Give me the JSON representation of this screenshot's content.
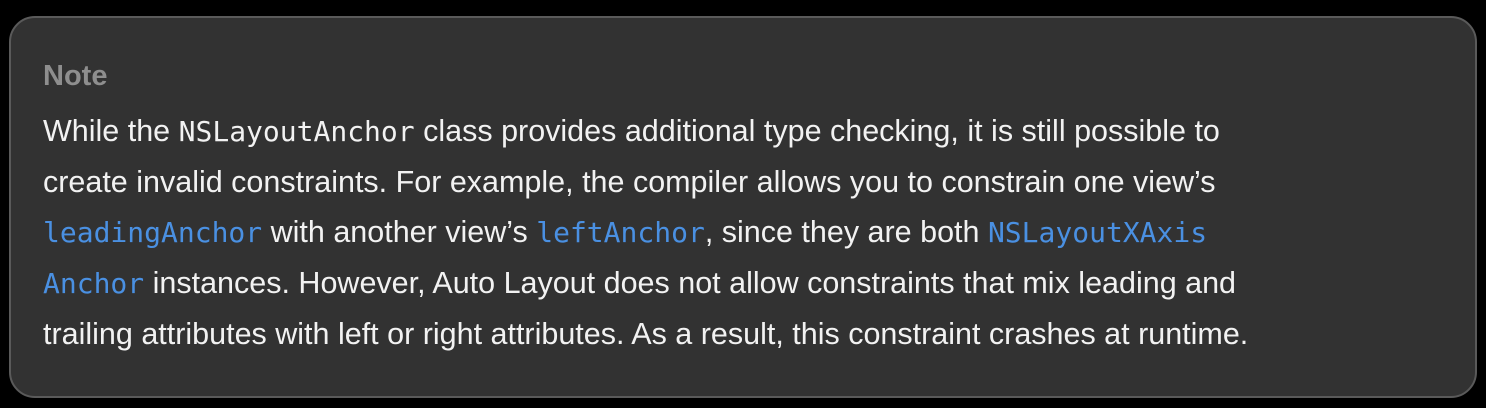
{
  "note": {
    "title": "Note",
    "lines": [
      {
        "t1": "While the ",
        "code_class": "NSLayoutAnchor",
        "t2": " class provides additional type checking, it is still possible to"
      },
      {
        "t1": "create invalid constraints. For example, the compiler allows you to constrain one view’s"
      },
      {
        "link_leading": "leadingAnchor",
        "t1": " with another view’s ",
        "link_left": "leftAnchor",
        "t2": ", since they are both ",
        "link_xaxis_part1": "NSLayoutXAxis"
      },
      {
        "link_xaxis_part2": "Anchor",
        "t1": " instances. However, Auto Layout does not allow constraints that mix leading and"
      },
      {
        "t1": "trailing attributes with left or right attributes. As a result, this constraint crashes at runtime."
      }
    ]
  },
  "colors": {
    "background": "#000000",
    "panel": "#323232",
    "panel_border": "#5a5a5a",
    "title": "#8e8e8e",
    "text": "#f2f2f2",
    "link": "#4a90e2"
  }
}
